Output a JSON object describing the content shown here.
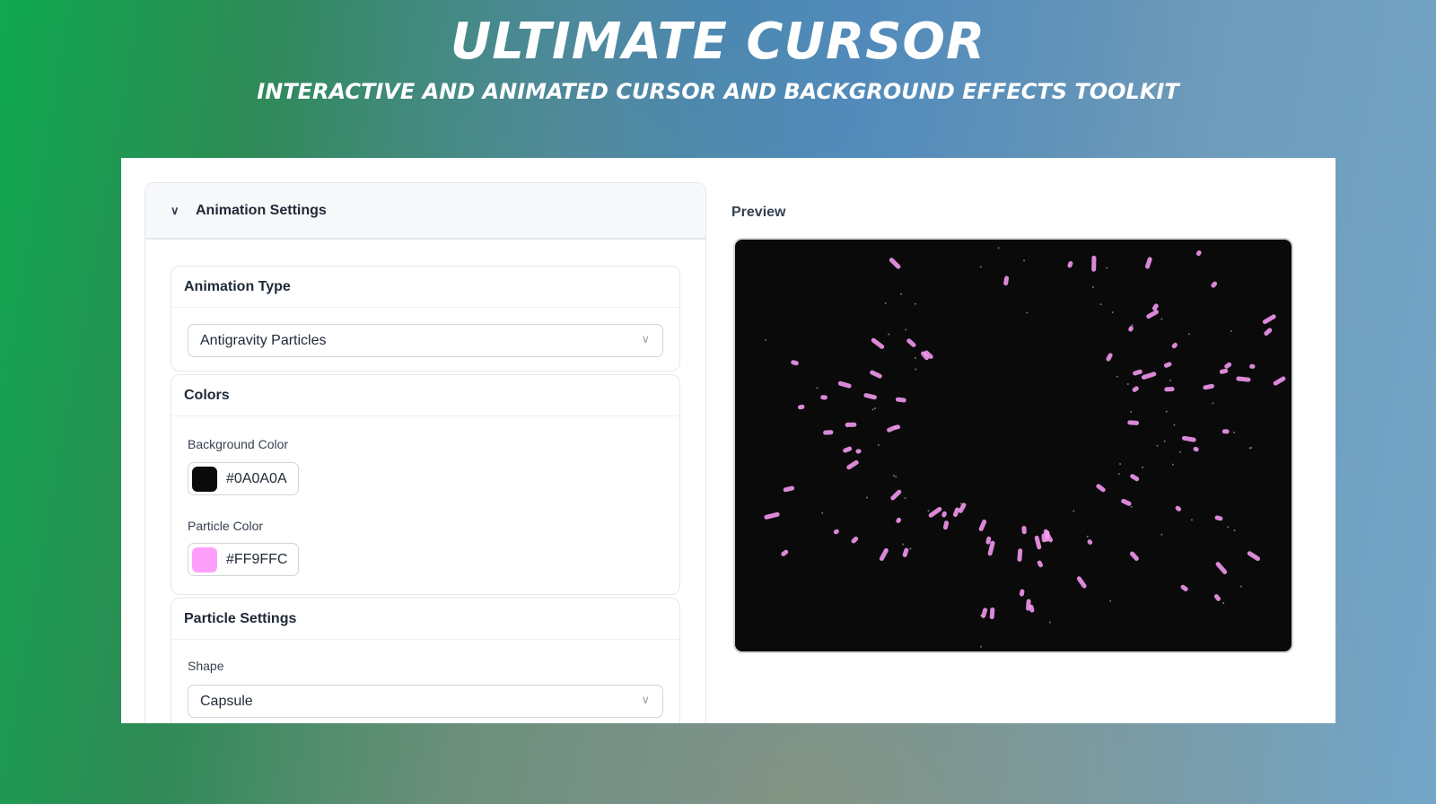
{
  "header": {
    "title": "Ultimate Cursor",
    "subtitle": "Interactive and animated cursor and background effects toolkit"
  },
  "settings": {
    "section_title": "Animation Settings",
    "animation_type": {
      "title": "Animation Type",
      "value": "Antigravity Particles"
    },
    "colors": {
      "title": "Colors",
      "background_label": "Background Color",
      "background_value": "#0A0A0A",
      "particle_label": "Particle Color",
      "particle_value": "#FF9FFC"
    },
    "particle_settings": {
      "title": "Particle Settings",
      "shape_label": "Shape",
      "shape_value": "Capsule"
    }
  },
  "preview": {
    "label": "Preview",
    "background": "#0a0a0a",
    "particle_color": "#FF9FFC"
  }
}
